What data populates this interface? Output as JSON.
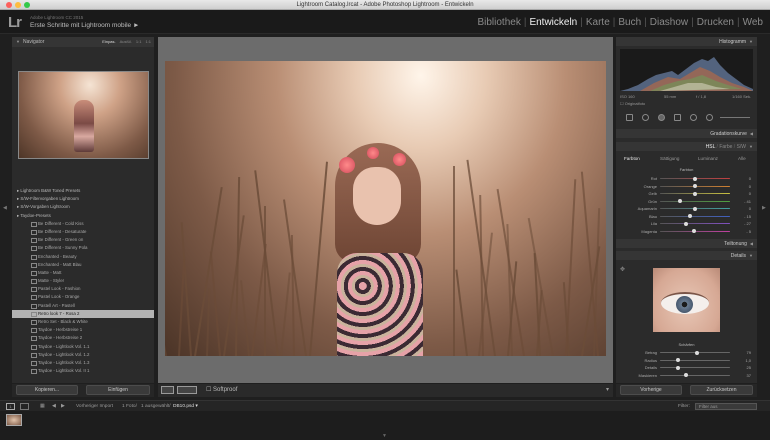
{
  "window": {
    "title": "Lightroom Catalog.lrcat - Adobe Photoshop Lightroom - Entwickeln",
    "traffic_lights": [
      "#fc605c",
      "#fdbc40",
      "#34c84a"
    ]
  },
  "identity": {
    "logo": "Lr",
    "product": "Adobe Lightroom CC 2015",
    "subtitle": "Erste Schritte mit Lightroom mobile ►"
  },
  "modules": [
    "Bibliothek",
    "Entwickeln",
    "Karte",
    "Buch",
    "Diashow",
    "Drucken",
    "Web"
  ],
  "active_module": "Entwickeln",
  "navigator": {
    "title": "Navigator",
    "options": [
      "Einpas.",
      "Ausfül.",
      "1:1",
      "1:1"
    ]
  },
  "presets": [
    {
      "label": "Lightroom B&W Toned Presets",
      "type": "folder"
    },
    {
      "label": "S/W-Filtervorgaben Lightroom",
      "type": "folder"
    },
    {
      "label": "S/W-Vorgaben Lightroom",
      "type": "folder"
    },
    {
      "label": "Taydoe-Presets",
      "type": "folder"
    },
    {
      "label": "Be Different - Cold Kiss",
      "type": "child"
    },
    {
      "label": "Be Different - Desaturate",
      "type": "child"
    },
    {
      "label": "Be Different - Green on",
      "type": "child"
    },
    {
      "label": "Be Different - Sunny Pola",
      "type": "child"
    },
    {
      "label": "Enchanted - Beauty",
      "type": "child"
    },
    {
      "label": "Enchanted - Matt Blau",
      "type": "child"
    },
    {
      "label": "Matte - Matt",
      "type": "child"
    },
    {
      "label": "Matte - Styler",
      "type": "child"
    },
    {
      "label": "Pastel Look - Fashion",
      "type": "child"
    },
    {
      "label": "Pastel Look - Orange",
      "type": "child"
    },
    {
      "label": "Pastell Art - Pastell",
      "type": "child"
    },
    {
      "label": "Retro look 7 - Rosa 2",
      "type": "child",
      "selected": true
    },
    {
      "label": "Retro Set - Black & White",
      "type": "child"
    },
    {
      "label": "Taydoe - Herbstreise 1",
      "type": "child"
    },
    {
      "label": "Taydoe - Herbstreise 2",
      "type": "child"
    },
    {
      "label": "Taydoe - Lightlook Vol. 1.1",
      "type": "child"
    },
    {
      "label": "Taydoe - Lightlook Vol. 1.2",
      "type": "child"
    },
    {
      "label": "Taydoe - Lightlook Vol. 1.3",
      "type": "child"
    },
    {
      "label": "Taydoe - Lightlook Vol. II 1",
      "type": "child"
    }
  ],
  "left_buttons": {
    "copy": "Kopieren...",
    "paste": "Einfügen"
  },
  "toolbar": {
    "softproof": "Softproof"
  },
  "histogram": {
    "title": "Histogramm",
    "iso": "ISO 160",
    "focal": "55 mm",
    "aperture": "f / 1,8",
    "shutter": "1/160 Sek.",
    "original": "Originalfoto"
  },
  "panels": {
    "gradation": "Gradationskurve",
    "hsl_tabs": [
      "HSL",
      "Farbe",
      "S/W"
    ],
    "sub_tabs": [
      "Farbton",
      "Sättigung",
      "Luminanz",
      "Alle"
    ],
    "section": "Farbton",
    "tone": "Teiltonung",
    "details": "Details"
  },
  "hsl_sliders": [
    {
      "label": "Rot",
      "value": "0",
      "pos": 0.5,
      "color": "#c04040"
    },
    {
      "label": "Orange",
      "value": "0",
      "pos": 0.5,
      "color": "#d08030"
    },
    {
      "label": "Gelb",
      "value": "0",
      "pos": 0.5,
      "color": "#c8c040"
    },
    {
      "label": "Grün",
      "value": "- 41",
      "pos": 0.29,
      "color": "#50a040"
    },
    {
      "label": "Aquamarin",
      "value": "0",
      "pos": 0.5,
      "color": "#40a0a0"
    },
    {
      "label": "Blau",
      "value": "- 15",
      "pos": 0.43,
      "color": "#4060c0"
    },
    {
      "label": "Lila",
      "value": "- 27",
      "pos": 0.37,
      "color": "#8050c0"
    },
    {
      "label": "Magenta",
      "value": "- 5",
      "pos": 0.48,
      "color": "#c040a0"
    }
  ],
  "sharpen": {
    "title": "Schärfen",
    "sliders": [
      {
        "label": "Betrag",
        "value": "79",
        "pos": 0.53
      },
      {
        "label": "Radius",
        "value": "1,0",
        "pos": 0.25
      },
      {
        "label": "Details",
        "value": "25",
        "pos": 0.25
      },
      {
        "label": "Maskieren",
        "value": "37",
        "pos": 0.37
      }
    ]
  },
  "right_buttons": {
    "previous": "Vorherige",
    "reset": "Zurücksetzen"
  },
  "bottom": {
    "import": "Vorheriger Import",
    "count": "1 Foto/",
    "selected": "1 ausgewählt/",
    "file": "DB10.psd ▾",
    "filter_label": "Filter:",
    "filter_value": "Filter aus"
  }
}
